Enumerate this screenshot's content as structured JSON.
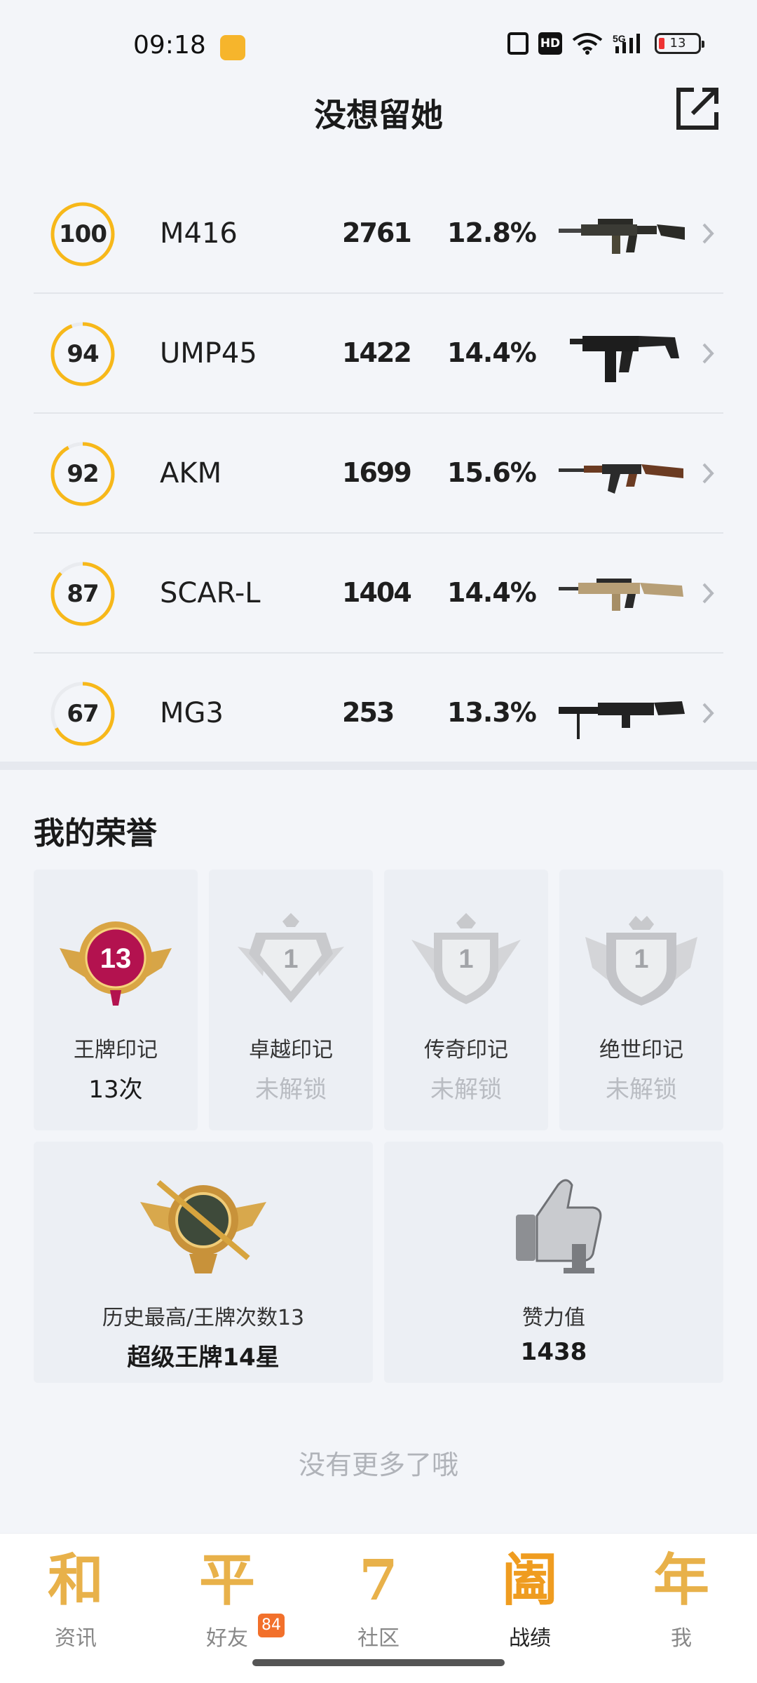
{
  "status": {
    "time": "09:18",
    "hd_label": "HD",
    "network": "5G",
    "battery": "13"
  },
  "header": {
    "title": "没想留她"
  },
  "weapons": [
    {
      "score": "100",
      "score_fraction": 1.0,
      "name": "M416",
      "kills": "2761",
      "rate": "12.8%",
      "gun_icon": "rifle-icon"
    },
    {
      "score": "94",
      "score_fraction": 0.94,
      "name": "UMP45",
      "kills": "1422",
      "rate": "14.4%",
      "gun_icon": "smg-icon"
    },
    {
      "score": "92",
      "score_fraction": 0.92,
      "name": "AKM",
      "kills": "1699",
      "rate": "15.6%",
      "gun_icon": "ak-icon"
    },
    {
      "score": "87",
      "score_fraction": 0.87,
      "name": "SCAR-L",
      "kills": "1404",
      "rate": "14.4%",
      "gun_icon": "scar-icon"
    },
    {
      "score": "67",
      "score_fraction": 0.67,
      "name": "MG3",
      "kills": "253",
      "rate": "13.3%",
      "gun_icon": "mg-icon"
    }
  ],
  "honors": {
    "title": "我的荣誉",
    "badges": [
      {
        "name": "王牌印记",
        "value": "13次",
        "badge_number": "13",
        "locked": false
      },
      {
        "name": "卓越印记",
        "value": "未解锁",
        "badge_number": "1",
        "locked": true
      },
      {
        "name": "传奇印记",
        "value": "未解锁",
        "badge_number": "1",
        "locked": true
      },
      {
        "name": "绝世印记",
        "value": "未解锁",
        "badge_number": "1",
        "locked": true
      }
    ],
    "history": {
      "label": "历史最高/王牌次数13",
      "value": "超级王牌14星"
    },
    "likes": {
      "label": "赞力值",
      "value": "1438"
    }
  },
  "footer_text": "没有更多了哦",
  "nav": [
    {
      "glyph": "和",
      "label": "资讯",
      "active": false,
      "badge": ""
    },
    {
      "glyph": "平",
      "label": "好友",
      "active": false,
      "badge": "84"
    },
    {
      "glyph": "7",
      "label": "社区",
      "active": false,
      "badge": ""
    },
    {
      "glyph": "阖",
      "label": "战绩",
      "active": true,
      "badge": ""
    },
    {
      "glyph": "年",
      "label": "我",
      "active": false,
      "badge": ""
    }
  ],
  "colors": {
    "ring": "#f7b81a",
    "ring_track": "#e9ebef",
    "accent": "#ef9c20"
  }
}
